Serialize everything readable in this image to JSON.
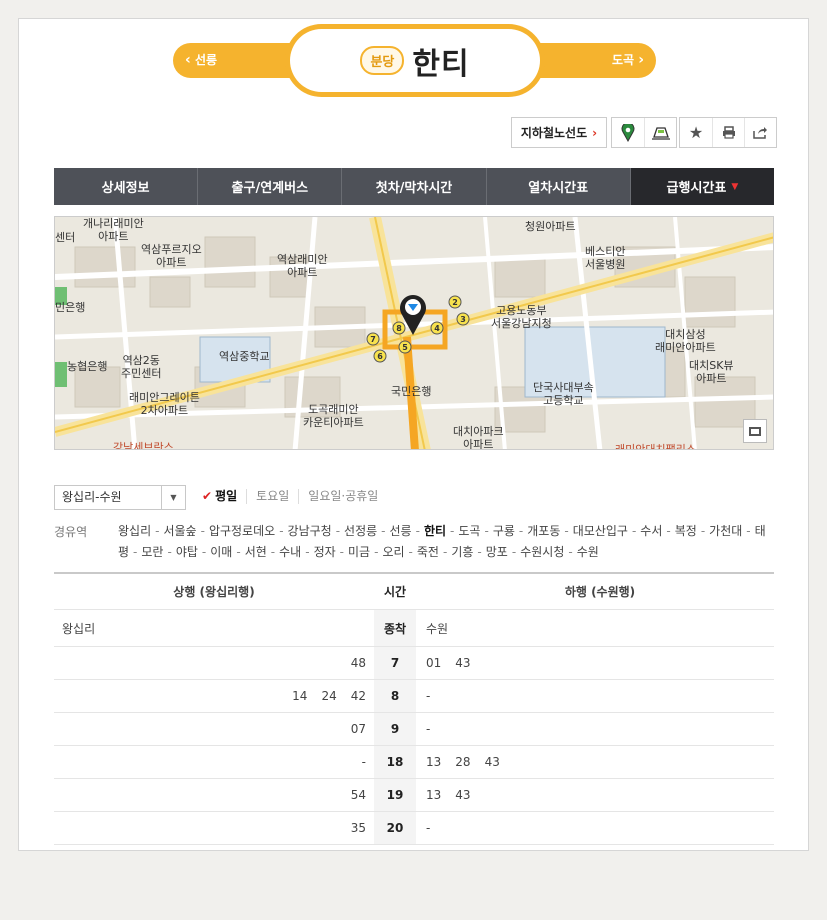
{
  "header": {
    "prev_station": "선릉",
    "next_station": "도곡",
    "line_badge": "분당",
    "station_name": "한티",
    "line_color": "#f5b32e"
  },
  "tools": {
    "subway_map_label": "지하철노선도"
  },
  "tabs": [
    {
      "label": "상세정보",
      "active": false
    },
    {
      "label": "출구/연계버스",
      "active": false
    },
    {
      "label": "첫차/막차시간",
      "active": false
    },
    {
      "label": "열차시간표",
      "active": false
    },
    {
      "label": "급행시간표",
      "active": true
    }
  ],
  "map": {
    "labels": [
      "개나리래미안 아파트",
      "역삼푸르지오 아파트",
      "역삼래미안 아파트",
      "청원아파트",
      "베스티안 서울병원",
      "민은행",
      "고용노동부 서울강남지청",
      "대치삼성 래미안아파트",
      "농협은행",
      "역삼2동 주민센터",
      "역삼중학교",
      "래미안그레이튼 2차아파트",
      "국민은행",
      "단국사대부속 고등학교",
      "대치SK뷰 아파트",
      "도곡래미안 카운티아파트",
      "대치아파크 아파트",
      "강남세브란스",
      "래미안대치팰리스",
      "센터"
    ],
    "exits": [
      "2",
      "3",
      "4",
      "5",
      "6",
      "7",
      "8"
    ]
  },
  "filters": {
    "direction": "왕십리-수원",
    "days": [
      {
        "label": "평일",
        "active": true
      },
      {
        "label": "토요일",
        "active": false
      },
      {
        "label": "일요일·공휴일",
        "active": false
      }
    ]
  },
  "via": {
    "label": "경유역",
    "stations": [
      "왕십리",
      "서울숲",
      "압구정로데오",
      "강남구청",
      "선정릉",
      "선릉",
      "한티",
      "도곡",
      "구룡",
      "개포동",
      "대모산입구",
      "수서",
      "복정",
      "가천대",
      "태평",
      "모란",
      "야탑",
      "이매",
      "서현",
      "수내",
      "정자",
      "미금",
      "오리",
      "죽전",
      "기흥",
      "망포",
      "수원시청",
      "수원"
    ],
    "current": "한티"
  },
  "timetable": {
    "up_header": "상행 (왕십리행)",
    "time_header": "시간",
    "down_header": "하행 (수원행)",
    "up_terminal": "왕십리",
    "terminal_label": "종착",
    "down_terminal": "수원",
    "rows": [
      {
        "hour": "7",
        "up": [
          "48"
        ],
        "down": [
          "01",
          "43"
        ]
      },
      {
        "hour": "8",
        "up": [
          "14",
          "24",
          "42"
        ],
        "down": [
          "-"
        ]
      },
      {
        "hour": "9",
        "up": [
          "07"
        ],
        "down": [
          "-"
        ]
      },
      {
        "hour": "18",
        "up": [
          "-"
        ],
        "down": [
          "13",
          "28",
          "43"
        ]
      },
      {
        "hour": "19",
        "up": [
          "54"
        ],
        "down": [
          "13",
          "43"
        ]
      },
      {
        "hour": "20",
        "up": [
          "35"
        ],
        "down": [
          "-"
        ]
      }
    ]
  }
}
